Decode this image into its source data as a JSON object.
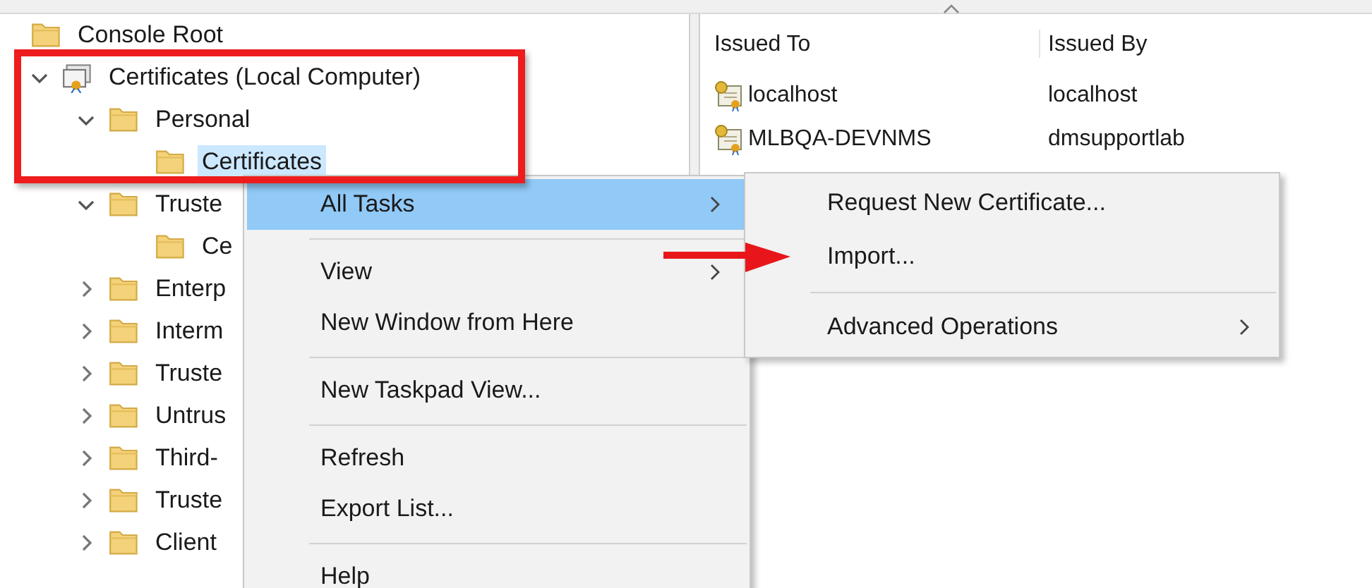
{
  "tree": [
    {
      "label": "Console Root",
      "kind": "folder",
      "selected": false,
      "children": [
        {
          "label": "Certificates (Local Computer)",
          "kind": "snapin",
          "selected": false,
          "expanded": true,
          "children": [
            {
              "label": "Personal",
              "kind": "folder",
              "selected": false,
              "expanded": true,
              "children": [
                {
                  "label": "Certificates",
                  "kind": "folder",
                  "selected": true
                }
              ]
            },
            {
              "label": "Truste",
              "kind": "folder",
              "selected": false,
              "expanded": true,
              "children": [
                {
                  "label": "Ce",
                  "kind": "folder",
                  "selected": false
                }
              ]
            },
            {
              "label": "Enterp",
              "kind": "folder",
              "selected": false,
              "expanded": false
            },
            {
              "label": "Interm",
              "kind": "folder",
              "selected": false,
              "expanded": false
            },
            {
              "label": "Truste",
              "kind": "folder",
              "selected": false,
              "expanded": false
            },
            {
              "label": "Untrus",
              "kind": "folder",
              "selected": false,
              "expanded": false
            },
            {
              "label": "Third-",
              "kind": "folder",
              "selected": false,
              "expanded": false
            },
            {
              "label": "Truste",
              "kind": "folder",
              "selected": false,
              "expanded": false
            },
            {
              "label": "Client",
              "kind": "folder",
              "selected": false,
              "expanded": false
            }
          ]
        }
      ]
    }
  ],
  "list": {
    "columns": [
      {
        "label": "Issued To",
        "sorted": true
      },
      {
        "label": "Issued By",
        "sorted": false
      }
    ],
    "rows": [
      {
        "cells": [
          "localhost",
          "localhost"
        ]
      },
      {
        "cells": [
          "MLBQA-DEVNMS",
          "dmsupportlab"
        ]
      }
    ]
  },
  "context_menu": [
    {
      "kind": "item",
      "label": "All Tasks",
      "selected": true,
      "submenu": true
    },
    {
      "kind": "separator"
    },
    {
      "kind": "item",
      "label": "View",
      "selected": false,
      "submenu": true
    },
    {
      "kind": "item",
      "label": "New Window from Here",
      "selected": false,
      "submenu": false
    },
    {
      "kind": "separator"
    },
    {
      "kind": "item",
      "label": "New Taskpad View...",
      "selected": false,
      "submenu": false
    },
    {
      "kind": "separator"
    },
    {
      "kind": "item",
      "label": "Refresh",
      "selected": false,
      "submenu": false
    },
    {
      "kind": "item",
      "label": "Export List...",
      "selected": false,
      "submenu": false
    },
    {
      "kind": "separator"
    },
    {
      "kind": "item",
      "label": "Help",
      "selected": false,
      "submenu": false
    }
  ],
  "submenu": [
    {
      "kind": "item",
      "label": "Request New Certificate...",
      "selected": false,
      "submenu": false
    },
    {
      "kind": "item",
      "label": "Import...",
      "selected": false,
      "submenu": false
    },
    {
      "kind": "separator"
    },
    {
      "kind": "item",
      "label": "Advanced Operations",
      "selected": false,
      "submenu": true
    }
  ],
  "annotation_marks": {
    "highlight_box": true,
    "arrow": true
  }
}
